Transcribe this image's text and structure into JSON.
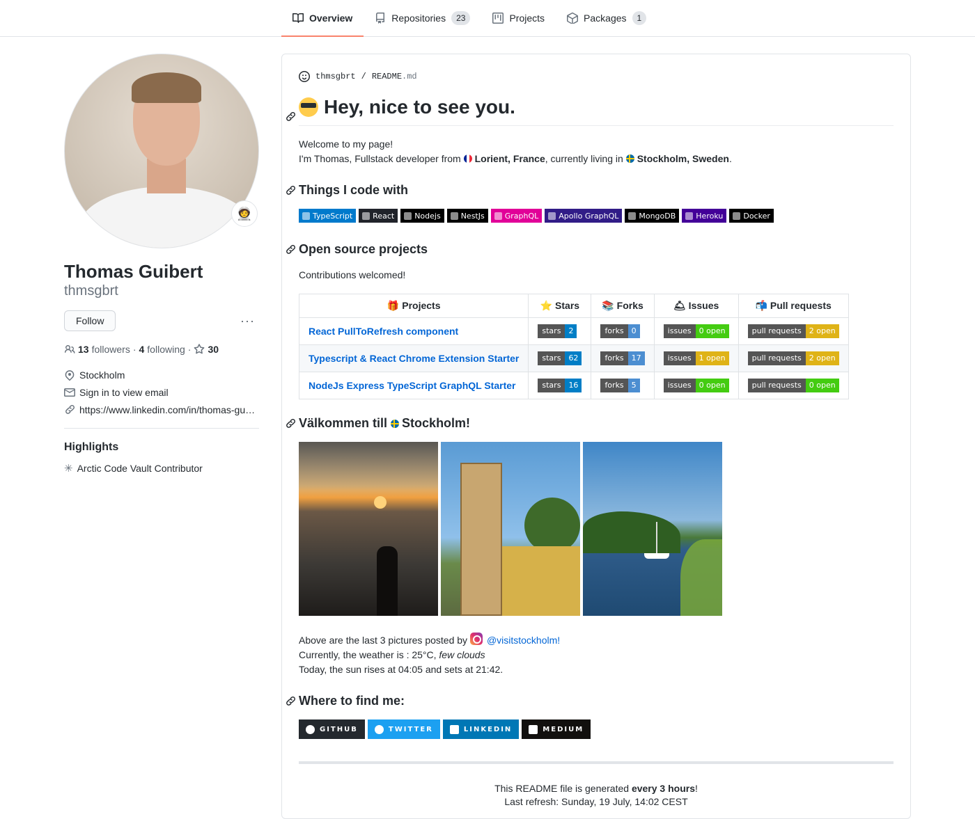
{
  "nav": {
    "tabs": [
      {
        "label": "Overview",
        "icon": "book-icon",
        "active": true
      },
      {
        "label": "Repositories",
        "icon": "repo-icon",
        "count": "23"
      },
      {
        "label": "Projects",
        "icon": "project-icon"
      },
      {
        "label": "Packages",
        "icon": "package-icon",
        "count": "1"
      }
    ]
  },
  "profile": {
    "status_emoji": "🧑‍🚀",
    "fullname": "Thomas Guibert",
    "username": "thmsgbrt",
    "follow_label": "Follow",
    "more_label": "···",
    "followers_count": "13",
    "followers_label": "followers",
    "following_count": "4",
    "following_label": "following",
    "stars_count": "30",
    "dot": "·",
    "location": "Stockholm",
    "email": "Sign in to view email",
    "website": "https://www.linkedin.com/in/thomas-gu…",
    "highlights_title": "Highlights",
    "highlight_item": "Arctic Code Vault Contributor"
  },
  "readme": {
    "owner": "thmsgbrt",
    "slash": "/",
    "file": "README",
    "ext": ".md",
    "heading": "Hey, nice to see you.",
    "welcome": "Welcome to my page!",
    "intro_a": "I'm Thomas, Fullstack developer from ",
    "from_city": "Lorient, France",
    "intro_b": ", currently living in ",
    "live_city": "Stockholm, Sweden",
    "intro_c": ".",
    "things_title": "Things I code with",
    "badges": [
      {
        "label": "TypeScript",
        "color": "#007acc"
      },
      {
        "label": "React",
        "color": "#20232a"
      },
      {
        "label": "Nodejs",
        "color": "#000000"
      },
      {
        "label": "NestJs",
        "color": "#000000"
      },
      {
        "label": "GraphQL",
        "color": "#e10098"
      },
      {
        "label": "Apollo GraphQL",
        "color": "#311c87"
      },
      {
        "label": "MongoDB",
        "color": "#000000"
      },
      {
        "label": "Heroku",
        "color": "#430098"
      },
      {
        "label": "Docker",
        "color": "#000000"
      }
    ],
    "oss_title": "Open source projects",
    "contrib": "Contributions welcomed!",
    "table_headers": [
      "🎁 Projects",
      "⭐ Stars",
      "📚 Forks",
      "🛎 Issues",
      "📬 Pull requests"
    ],
    "projects": [
      {
        "name": "React PullToRefresh component",
        "stars_l": "stars",
        "stars": "2",
        "forks_l": "forks",
        "forks": "0",
        "issues_l": "issues",
        "issues": "0 open",
        "issues_color": "#4c1",
        "pr_l": "pull requests",
        "pr": "2 open",
        "pr_color": "#dfb317"
      },
      {
        "name": "Typescript & React Chrome Extension Starter",
        "stars_l": "stars",
        "stars": "62",
        "forks_l": "forks",
        "forks": "17",
        "issues_l": "issues",
        "issues": "1 open",
        "issues_color": "#dfb317",
        "pr_l": "pull requests",
        "pr": "2 open",
        "pr_color": "#dfb317"
      },
      {
        "name": "NodeJs Express TypeScript GraphQL Starter",
        "stars_l": "stars",
        "stars": "16",
        "forks_l": "forks",
        "forks": "5",
        "issues_l": "issues",
        "issues": "0 open",
        "issues_color": "#4c1",
        "pr_l": "pull requests",
        "pr": "0 open",
        "pr_color": "#4c1"
      }
    ],
    "stockholm_a": "Välkommen till ",
    "stockholm_b": "Stockholm!",
    "pics_a": "Above are the last 3 pictures posted by ",
    "pics_handle": "@visitstockholm!",
    "weather_a": "Currently, the weather is : 25°C, ",
    "weather_b": "few clouds",
    "sun": "Today, the sun rises at 04:05 and sets at 21:42.",
    "find_title": "Where to find me:",
    "social": [
      {
        "label": "GITHUB",
        "color": "#24292e"
      },
      {
        "label": "TWITTER",
        "color": "#1ca0f1"
      },
      {
        "label": "LINKEDIN",
        "color": "#0077b5"
      },
      {
        "label": "MEDIUM",
        "color": "#12100e"
      }
    ],
    "footer_a": "This README file is generated ",
    "footer_b": "every 3 hours",
    "footer_c": "!",
    "footer_refresh": "Last refresh: Sunday, 19 July, 14:02 CEST"
  }
}
